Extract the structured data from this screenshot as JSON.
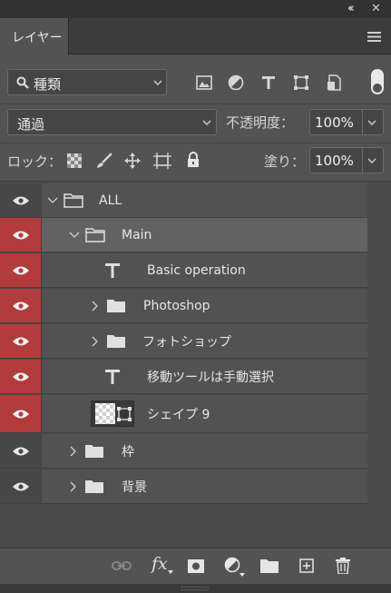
{
  "panel": {
    "tab_label": "レイヤー",
    "collapse_glyph": "‹‹",
    "close_glyph": "✕"
  },
  "filter": {
    "kind_value": "種類",
    "icons": [
      "image-filter-icon",
      "adjustment-filter-icon",
      "type-filter-icon",
      "shape-filter-icon",
      "smart-object-filter-icon"
    ]
  },
  "blend": {
    "mode_value": "通過",
    "opacity_label": "不透明度：",
    "opacity_value": "100%"
  },
  "lock": {
    "label": "ロック：",
    "fill_label": "塗り：",
    "fill_value": "100%"
  },
  "layers": [
    {
      "name": "ALL",
      "type": "group",
      "visible_red": false,
      "expanded": true,
      "selected": false
    },
    {
      "name": "Main",
      "type": "group",
      "visible_red": true,
      "expanded": true,
      "selected": true
    },
    {
      "name": "Basic operation",
      "type": "text",
      "visible_red": true,
      "selected": false
    },
    {
      "name": "Photoshop",
      "type": "group",
      "visible_red": true,
      "expanded": false,
      "selected": false
    },
    {
      "name": "フォトショップ",
      "type": "group",
      "visible_red": true,
      "expanded": false,
      "selected": false
    },
    {
      "name": "移動ツールは手動選択",
      "type": "text",
      "visible_red": true,
      "selected": false
    },
    {
      "name": "シェイプ 9",
      "type": "shape",
      "visible_red": true,
      "selected": false
    },
    {
      "name": "枠",
      "type": "group",
      "visible_red": false,
      "expanded": false,
      "selected": false
    },
    {
      "name": "背景",
      "type": "group",
      "visible_red": false,
      "expanded": false,
      "selected": false
    }
  ],
  "bottom": {
    "fx_label": "fx"
  },
  "colors": {
    "visibility_red": "#b23b3b",
    "panel_bg": "#535353"
  }
}
